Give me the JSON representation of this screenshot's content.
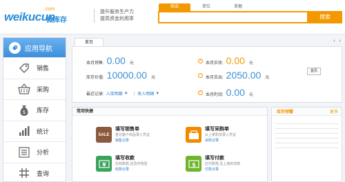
{
  "header": {
    "logo_main": "weikucun",
    "logo_com": ".com",
    "logo_cn": "微库存",
    "slogan": [
      "提升服务生产力",
      "提高资金利用率"
    ],
    "search_tabs": [
      "商品",
      "单位",
      "单据"
    ],
    "search_placeholder": "",
    "search_button": "搜索"
  },
  "sidebar": {
    "title": "应用导航",
    "items": [
      {
        "label": "销售",
        "icon": "tag-icon"
      },
      {
        "label": "采购",
        "icon": "basket-icon"
      },
      {
        "label": "库存",
        "icon": "money-bag-icon"
      },
      {
        "label": "统计",
        "icon": "bar-chart-icon"
      },
      {
        "label": "分析",
        "icon": "list-icon"
      },
      {
        "label": "查询",
        "icon": "grid-icon"
      }
    ]
  },
  "tabs": {
    "home": "首页",
    "prev": "‹",
    "next": "›"
  },
  "summary": {
    "month_sales_label": "本月销售:",
    "month_sales_value": "0.00",
    "month_sales_unit": "元",
    "month_received_label": "本月实收:",
    "month_received_value": "0.00",
    "month_received_unit": "元",
    "inventory_value_label": "库存价值:",
    "inventory_value": "10000.00",
    "inventory_unit": "元",
    "month_expense_label": "本月支出:",
    "month_expense_value": "2050.00",
    "month_expense_unit": "元",
    "month_profit_label": "本月利润:",
    "month_profit_value": "0.00",
    "month_profit_unit": "元",
    "recent_label": "最近记录:",
    "recent_link_1": "入库明细",
    "recent_link_2": "收入明细",
    "home_button": "首页",
    "colors": {
      "blue": "#3c8fd7",
      "orange": "#f39800"
    }
  },
  "quick": {
    "title": "常用快捷",
    "actions": [
      {
        "title": "填写销售单",
        "desc": "登记客户商品录入凭证",
        "link": "销售记录",
        "icon": "sale-icon",
        "color": "#8b5a3c"
      },
      {
        "title": "填写采购单",
        "desc": "从上家购货录入凭证",
        "link": "采购记录",
        "icon": "purchase-icon",
        "color": "#f08a00"
      },
      {
        "title": "填写收款",
        "desc": "应收账款,应及时收回",
        "link": "收款记录",
        "icon": "receive-money-icon",
        "color": "#3aa35b"
      },
      {
        "title": "填写付款",
        "desc": "应付账款,及上家的货款",
        "link": "付款记录",
        "icon": "pay-money-icon",
        "color": "#6fb52c"
      }
    ]
  },
  "stock": {
    "title": "库存预警",
    "more": "更多"
  }
}
